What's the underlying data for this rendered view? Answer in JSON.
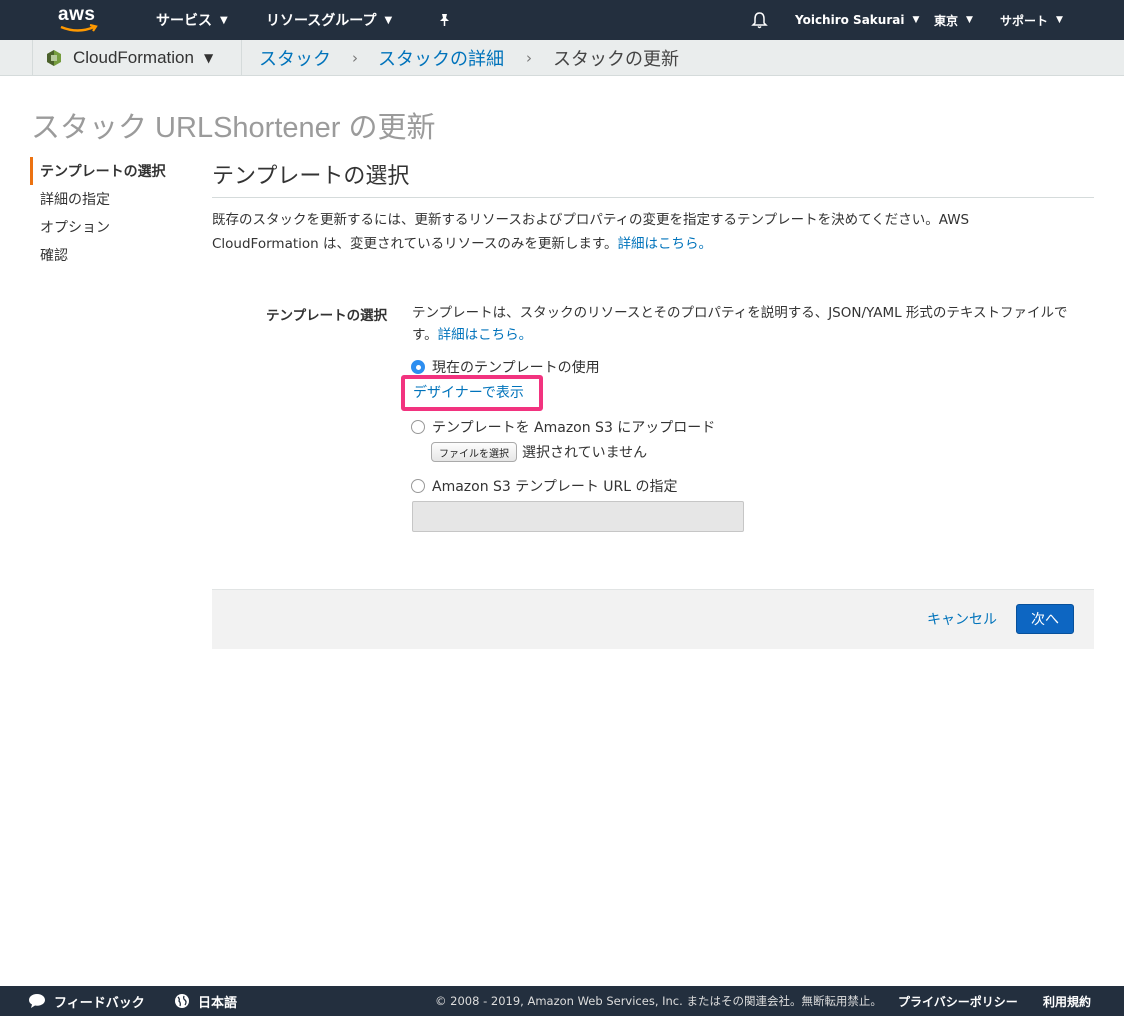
{
  "topnav": {
    "logo_text": "aws",
    "services": "サービス",
    "resource_groups": "リソースグループ",
    "user": "Yoichiro Sakurai",
    "region": "東京",
    "support": "サポート"
  },
  "breadcrumb": {
    "service": "CloudFormation",
    "items": [
      "スタック",
      "スタックの詳細",
      "スタックの更新"
    ]
  },
  "page": {
    "title": "スタック URLShortener の更新"
  },
  "steps": [
    "テンプレートの選択",
    "詳細の指定",
    "オプション",
    "確認"
  ],
  "section": {
    "title": "テンプレートの選択",
    "description": "既存のスタックを更新するには、更新するリソースおよびプロパティの変更を指定するテンプレートを決めてください。AWS CloudFormation は、変更されているリソースのみを更新します。",
    "learn_more": "詳細はこちら。"
  },
  "template_field": {
    "label": "テンプレートの選択",
    "help": "テンプレートは、スタックのリソースとそのプロパティを説明する、JSON/YAML 形式のテキストファイルです。",
    "learn_more": "詳細はこちら。",
    "option_current": "現在のテンプレートの使用",
    "view_in_designer": "デザイナーで表示",
    "option_upload": "テンプレートを Amazon S3 にアップロード",
    "file_button": "ファイルを選択",
    "file_status": "選択されていません",
    "option_url": "Amazon S3 テンプレート URL の指定",
    "url_value": ""
  },
  "actions": {
    "cancel": "キャンセル",
    "next": "次へ"
  },
  "footer": {
    "feedback": "フィードバック",
    "language": "日本語",
    "copyright": "© 2008 - 2019, Amazon Web Services, Inc. またはその関連会社。無断転用禁止。",
    "privacy": "プライバシーポリシー",
    "terms": "利用規約"
  },
  "colors": {
    "nav_bg": "#232f3e",
    "link": "#0073bb",
    "primary_button": "#0d66c2",
    "active_step": "#ec7211",
    "highlight": "#f2337f"
  }
}
